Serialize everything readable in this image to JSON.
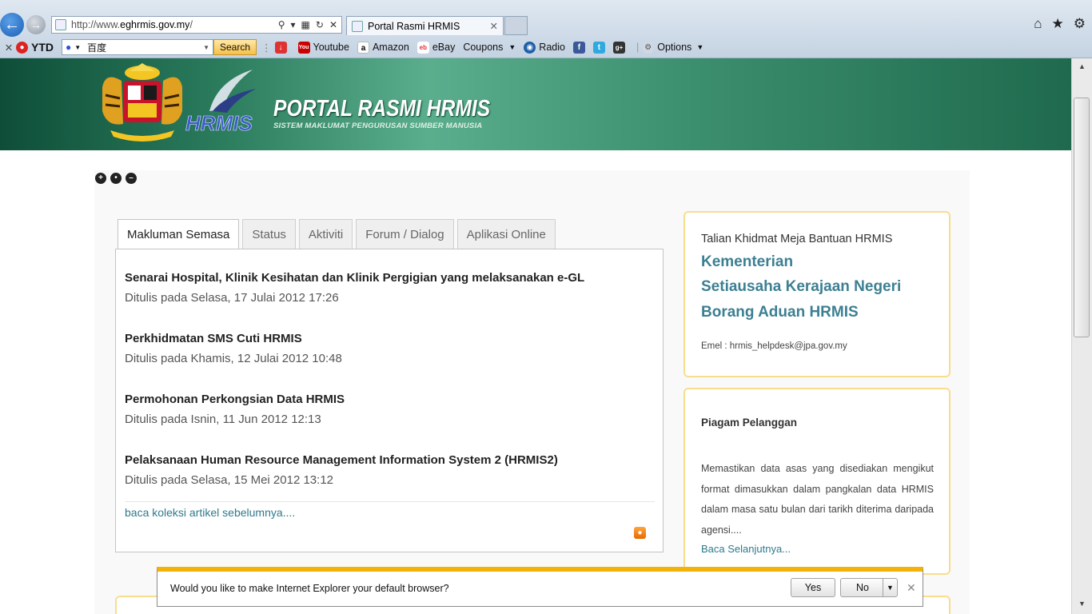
{
  "browser": {
    "address_url_prefix": "http://www.",
    "address_url_domain": "eghrmis.gov.my",
    "address_url_suffix": "/",
    "tab_title": "Portal Rasmi HRMIS",
    "toolbar": {
      "ytd_label": "YTD",
      "search_box_value": "百度",
      "search_button": "Search",
      "youtube": "Youtube",
      "amazon": "Amazon",
      "ebay": "eBay",
      "coupons": "Coupons",
      "radio": "Radio",
      "options": "Options"
    }
  },
  "header": {
    "title": "PORTAL RASMI HRMIS",
    "subtitle": "SISTEM MAKLUMAT PENGURUSAN SUMBER MANUSIA",
    "logo_text": "HRMIS"
  },
  "tabs": [
    {
      "label": "Makluman Semasa"
    },
    {
      "label": "Status"
    },
    {
      "label": "Aktiviti"
    },
    {
      "label": "Forum / Dialog"
    },
    {
      "label": "Aplikasi Online"
    }
  ],
  "news": [
    {
      "title": "Senarai Hospital, Klinik Kesihatan dan Klinik Pergigian yang melaksanakan e-GL",
      "date": "Ditulis pada Selasa, 17 Julai 2012 17:26"
    },
    {
      "title": "Perkhidmatan SMS Cuti HRMIS",
      "date": "Ditulis pada Khamis, 12 Julai 2012 10:48"
    },
    {
      "title": "Permohonan Perkongsian Data HRMIS",
      "date": "Ditulis pada Isnin, 11 Jun 2012 12:13"
    },
    {
      "title": "Pelaksanaan Human Resource Management Information System 2 (HRMIS2)",
      "date": "Ditulis pada Selasa, 15 Mei 2012 13:12"
    }
  ],
  "more_link": "baca koleksi artikel sebelumnya....",
  "helpdesk": {
    "title": "Talian Khidmat Meja Bantuan HRMIS",
    "links": [
      "Kementerian",
      "Setiausaha Kerajaan Negeri",
      "Borang Aduan HRMIS"
    ],
    "email": "Emel : hrmis_helpdesk@jpa.gov.my"
  },
  "piagam": {
    "title": "Piagam Pelanggan",
    "text": "Memastikan data asas yang disediakan mengikut format dimasukkan dalam pangkalan data HRMIS dalam masa satu bulan dari tarikh diterima daripada agensi....",
    "link": "Baca Selanjutnya..."
  },
  "notification": {
    "text": "Would you like to make Internet Explorer your default browser?",
    "yes": "Yes",
    "no": "No"
  },
  "colors": {
    "banner_green": "#3b8e6e",
    "link_teal": "#3c7f92",
    "box_border": "#f7de8f",
    "notify_bar": "#f2b208"
  }
}
